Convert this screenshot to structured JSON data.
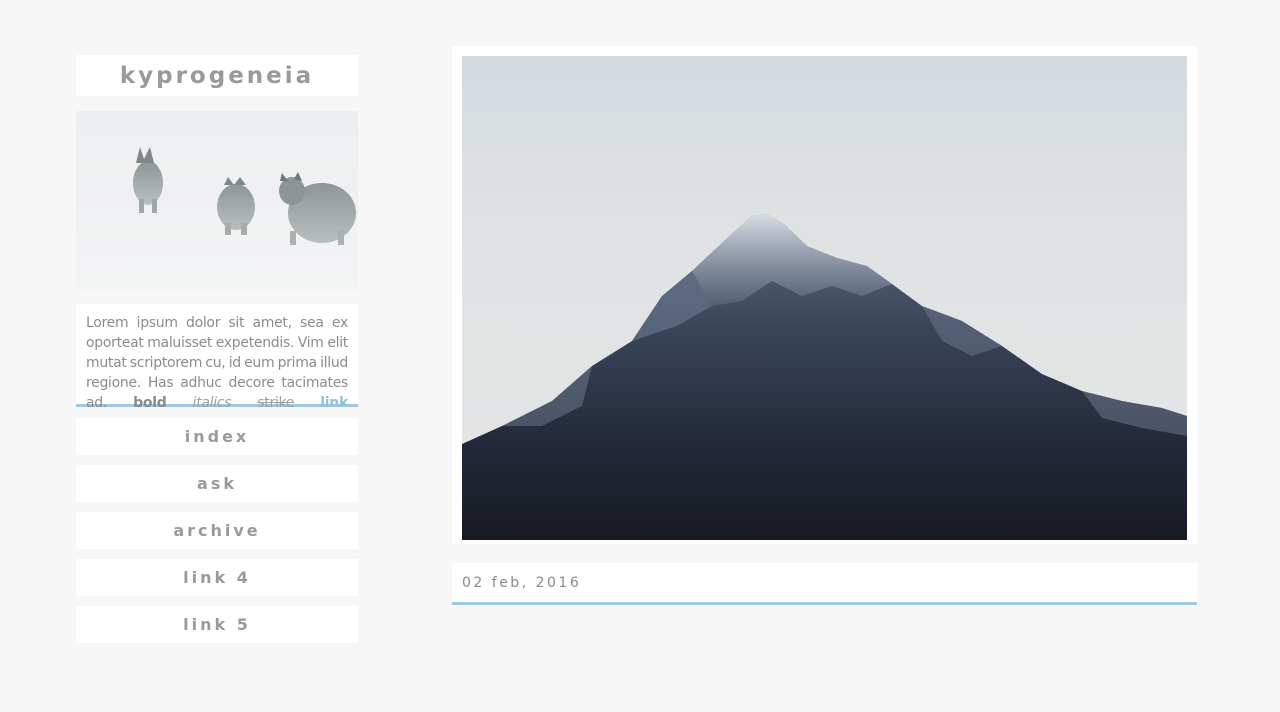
{
  "blog": {
    "title": "kyprogeneia"
  },
  "sidebar": {
    "description": {
      "body": "Lorem ipsum dolor sit amet, sea ex oporteat maluisset expetendis. Vim elit mutat scriptorem cu, id eum prima illud regione. Has adhuc decore tacimates ad.",
      "bold": "bold",
      "italics": "italics",
      "strike": "strike",
      "link": "link"
    },
    "nav": [
      {
        "label": "index"
      },
      {
        "label": "ask"
      },
      {
        "label": "archive"
      },
      {
        "label": "link 4"
      },
      {
        "label": "link 5"
      }
    ]
  },
  "post": {
    "date": "02 feb, 2016"
  },
  "colors": {
    "accent": "#9ec9e0",
    "text": "#9a9a9a",
    "background": "#f7f7f7"
  }
}
